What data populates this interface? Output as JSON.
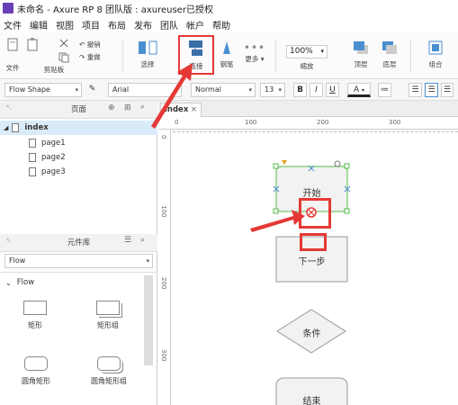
{
  "window": {
    "title": "未命名 - Axure RP 8 团队版 : axureuser已授权"
  },
  "menubar": {
    "items": [
      "文件",
      "编辑",
      "视图",
      "项目",
      "布局",
      "发布",
      "团队",
      "帐户",
      "帮助"
    ]
  },
  "toolbar": {
    "file": "文件",
    "clipboard": "剪贴板",
    "undo": "撤销",
    "redo": "重做",
    "select": "选择",
    "connect": "连接",
    "pen": "钢笔",
    "more": "更多 ▾",
    "zoom_value": "100%",
    "zoom_label": "缩放",
    "top": "顶层",
    "bottom": "底层",
    "group": "组合"
  },
  "formatbar": {
    "shape_type": "Flow Shape",
    "font": "Arial",
    "font_style": "Normal",
    "font_size": "13",
    "bold": "B",
    "italic": "I",
    "underline": "U",
    "font_color": "A"
  },
  "pages_panel": {
    "title": "页面",
    "root": "index",
    "pages": [
      "page1",
      "page2",
      "page3"
    ]
  },
  "widgets_panel": {
    "title": "元件库",
    "library": "Flow",
    "section": "Flow",
    "items": [
      "矩形",
      "矩形组",
      "圆角矩形",
      "圆角矩形组"
    ]
  },
  "canvas": {
    "tab": "index",
    "ruler_h": [
      "0",
      "100",
      "200",
      "300"
    ],
    "ruler_v": [
      "0",
      "100",
      "200",
      "300"
    ],
    "shapes": {
      "start": "开始",
      "next": "下一步",
      "condition": "条件",
      "end": "结束"
    }
  },
  "colors": {
    "annotation_red": "#e53935",
    "selection_green": "#54b948",
    "brand_purple": "#6a3fb5"
  }
}
